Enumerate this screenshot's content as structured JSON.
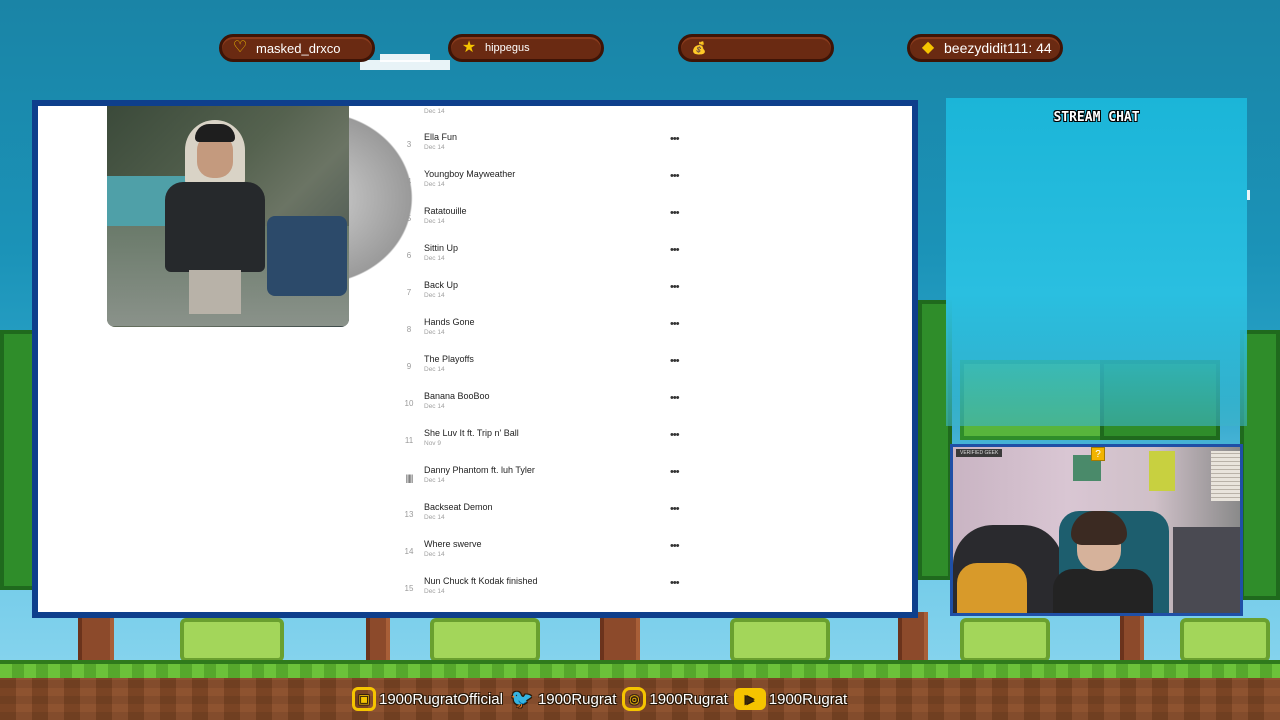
{
  "alerts": [
    {
      "icon": "heart-icon",
      "glyph": "♡",
      "label": "masked_drxco"
    },
    {
      "icon": "star-icon",
      "glyph": "★",
      "label": "hippegus"
    },
    {
      "icon": "money-bag-icon",
      "glyph": "💰",
      "label": ""
    },
    {
      "icon": "diamond-icon",
      "glyph": "◆",
      "label": "beezydidit111: 44"
    }
  ],
  "tracklist": {
    "partial_top": {
      "date": "Dec 14"
    },
    "tracks": [
      {
        "num": "3",
        "title": "Ella Fun",
        "date": "Dec 14"
      },
      {
        "num": "4",
        "title": "Youngboy Mayweather",
        "date": "Dec 14"
      },
      {
        "num": "5",
        "title": "Ratatouille",
        "date": "Dec 14"
      },
      {
        "num": "6",
        "title": "Sittin Up",
        "date": "Dec 14"
      },
      {
        "num": "7",
        "title": "Back Up",
        "date": "Dec 14"
      },
      {
        "num": "8",
        "title": "Hands Gone",
        "date": "Dec 14"
      },
      {
        "num": "9",
        "title": "The Playoffs",
        "date": "Dec 14"
      },
      {
        "num": "10",
        "title": "Banana BooBoo",
        "date": "Dec 14"
      },
      {
        "num": "11",
        "title": "She Luv It ft. Trip n' Ball",
        "date": "Nov 9"
      },
      {
        "num": "",
        "title": "Danny Phantom ft. luh Tyler",
        "date": "Dec 14",
        "playing": true
      },
      {
        "num": "13",
        "title": "Backseat Demon",
        "date": "Dec 14"
      },
      {
        "num": "14",
        "title": "Where swerve",
        "date": "Dec 14"
      },
      {
        "num": "15",
        "title": "Nun Chuck ft Kodak finished",
        "date": "Dec 14"
      }
    ],
    "more_glyph": "•••",
    "playing_glyph": "|||||"
  },
  "chat": {
    "title": "STREAM CHAT"
  },
  "webcam": {
    "badge": "VERIFIED GEEK",
    "question_block": "?"
  },
  "socials": [
    {
      "icon": "twitch-icon",
      "glyph": "▣",
      "handle": "1900RugratOfficial"
    },
    {
      "icon": "twitter-icon",
      "glyph": "🐦",
      "handle": "1900Rugrat"
    },
    {
      "icon": "instagram-icon",
      "glyph": "◎",
      "handle": "1900Rugrat"
    },
    {
      "icon": "youtube-icon",
      "glyph": "▶",
      "handle": "1900Rugrat"
    }
  ]
}
